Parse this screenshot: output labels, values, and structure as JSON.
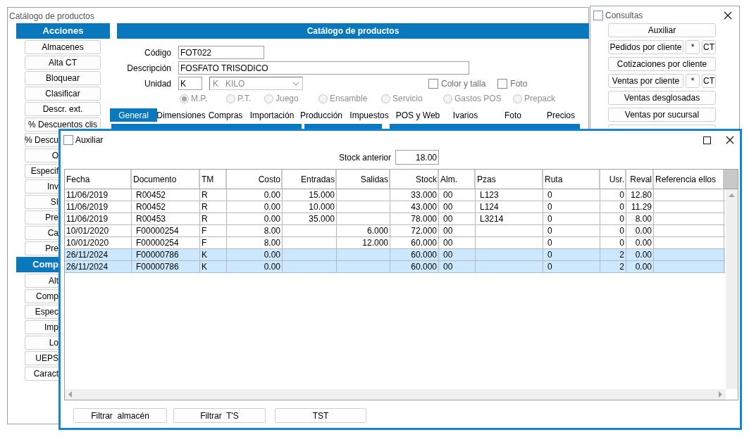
{
  "main_window": {
    "title": "Catálogo de productos"
  },
  "actions_panel": {
    "header": "Acciones",
    "buttons": [
      {
        "label": "Almacenes",
        "cut": false
      },
      {
        "label": "Alta CT",
        "cut": false
      },
      {
        "label": "Bloquear",
        "cut": false
      },
      {
        "label": "Clasificar",
        "cut": false
      },
      {
        "label": "Descr. ext.",
        "cut": false
      },
      {
        "label": "%  Descuentos clis",
        "cut": false
      },
      {
        "label": "%  Descu",
        "cut": true
      },
      {
        "label": "O",
        "cut": true
      },
      {
        "label": "Especif",
        "cut": true
      },
      {
        "label": "Inv",
        "cut": true
      },
      {
        "label": "SI",
        "cut": true
      },
      {
        "label": "Pre",
        "cut": true
      },
      {
        "label": "Ca",
        "cut": true
      },
      {
        "label": "Pre",
        "cut": true
      }
    ],
    "header_2": "Comp",
    "buttons_2": [
      {
        "label": "Alt",
        "cut": true
      },
      {
        "label": "Comp",
        "cut": true
      },
      {
        "label": "Espec",
        "cut": true
      },
      {
        "label": "Imp",
        "cut": true
      },
      {
        "label": "Lo",
        "cut": true
      },
      {
        "label": "UEPS",
        "cut": true
      },
      {
        "label": "Caract",
        "cut": true
      }
    ]
  },
  "product_form": {
    "header": "Catálogo de productos",
    "fields": [
      {
        "label": "Código",
        "value": "FOT022"
      },
      {
        "label": "Descripción",
        "value": "FOSFATO TRISODICO"
      }
    ],
    "unit": {
      "label": "Unidad",
      "value": "K",
      "select_value": "K   KILO"
    },
    "options": [
      {
        "label": "Color y talla",
        "checked": false
      },
      {
        "label": "Foto",
        "checked": false
      }
    ],
    "types": [
      {
        "label": "M.P.",
        "selected": true,
        "disabled": true
      },
      {
        "label": "P.T.",
        "selected": false,
        "disabled": true
      },
      {
        "label": "Juego",
        "selected": false,
        "disabled": true
      },
      {
        "label": "Ensamble",
        "selected": false,
        "disabled": true
      },
      {
        "label": "Servicio",
        "selected": false,
        "disabled": true
      },
      {
        "label": "Gastos POS",
        "selected": false,
        "disabled": true
      },
      {
        "label": "Prepack",
        "selected": false,
        "disabled": true
      }
    ],
    "tabs": [
      {
        "label": "General",
        "selected": true
      },
      {
        "label": "Dimensiones",
        "selected": false
      },
      {
        "label": "Compras",
        "selected": false
      },
      {
        "label": "Importación",
        "selected": false
      },
      {
        "label": "Producción",
        "selected": false
      },
      {
        "label": "Impuestos",
        "selected": false
      },
      {
        "label": "POS y Web",
        "selected": false
      },
      {
        "label": "Ivarios",
        "selected": false
      },
      {
        "label": "Foto",
        "selected": false
      },
      {
        "label": "Precios",
        "selected": false
      }
    ]
  },
  "consultas": {
    "title": "Consultas",
    "buttons": [
      {
        "label": "Auxiliar"
      },
      {
        "label": "Pedidos por cliente",
        "extras": [
          "*",
          "CT"
        ]
      },
      {
        "label": "Cotizaciones por cliente"
      },
      {
        "label": "Ventas por cliente",
        "extras": [
          "*",
          "CT"
        ]
      },
      {
        "label": "Ventas desglosadas"
      },
      {
        "label": "Ventas por sucursal"
      }
    ]
  },
  "auxiliar": {
    "title": "Auxiliar",
    "stock_label": "Stock anterior",
    "stock_value": "18.00",
    "columns": [
      "Fecha",
      "Documento",
      "TM",
      "Costo",
      "Entradas",
      "Salidas",
      "Stock",
      "Alm.",
      "Pzas",
      "Ruta",
      "Usr.",
      "Reval",
      "Referencia ellos"
    ],
    "rows": [
      {
        "fecha": "11/06/2019",
        "documento": "R00452",
        "tm": "R",
        "costo": "0.00",
        "entradas": "15.000",
        "stock": "33.000",
        "alm": "00",
        "pzas": "L123",
        "ruta": "0",
        "usr": "0",
        "reval": "12.80",
        "selected": false
      },
      {
        "fecha": "11/06/2019",
        "documento": "R00452",
        "tm": "R",
        "costo": "0.00",
        "entradas": "10.000",
        "stock": "43.000",
        "alm": "00",
        "pzas": "L124",
        "ruta": "0",
        "usr": "0",
        "reval": "11.29",
        "selected": false
      },
      {
        "fecha": "11/06/2019",
        "documento": "R00453",
        "tm": "R",
        "costo": "0.00",
        "entradas": "35.000",
        "stock": "78.000",
        "alm": "00",
        "pzas": "L3214",
        "ruta": "0",
        "usr": "0",
        "reval": "8.00",
        "selected": false
      },
      {
        "fecha": "10/01/2020",
        "documento": "F00000254",
        "tm": "F",
        "costo": "8.00",
        "salidas": "6.000",
        "stock": "72.000",
        "alm": "00",
        "ruta": "0",
        "usr": "0",
        "reval": "0.00",
        "selected": false
      },
      {
        "fecha": "10/01/2020",
        "documento": "F00000254",
        "tm": "F",
        "costo": "8.00",
        "salidas": "12.000",
        "stock": "60.000",
        "alm": "00",
        "ruta": "0",
        "usr": "0",
        "reval": "0.00",
        "selected": false
      },
      {
        "fecha": "26/11/2024",
        "documento": "F00000786",
        "tm": "K",
        "costo": "0.00",
        "stock": "60.000",
        "alm": "00",
        "ruta": "0",
        "usr": "2",
        "reval": "0.00",
        "selected": true
      },
      {
        "fecha": "26/11/2024",
        "documento": "F00000786",
        "tm": "K",
        "costo": "0.00",
        "stock": "60.000",
        "alm": "00",
        "ruta": "0",
        "usr": "2",
        "reval": "0.00",
        "selected": true
      }
    ],
    "buttons": [
      "Filtrar  almacén",
      "Filtrar  T'S",
      "TST"
    ]
  }
}
